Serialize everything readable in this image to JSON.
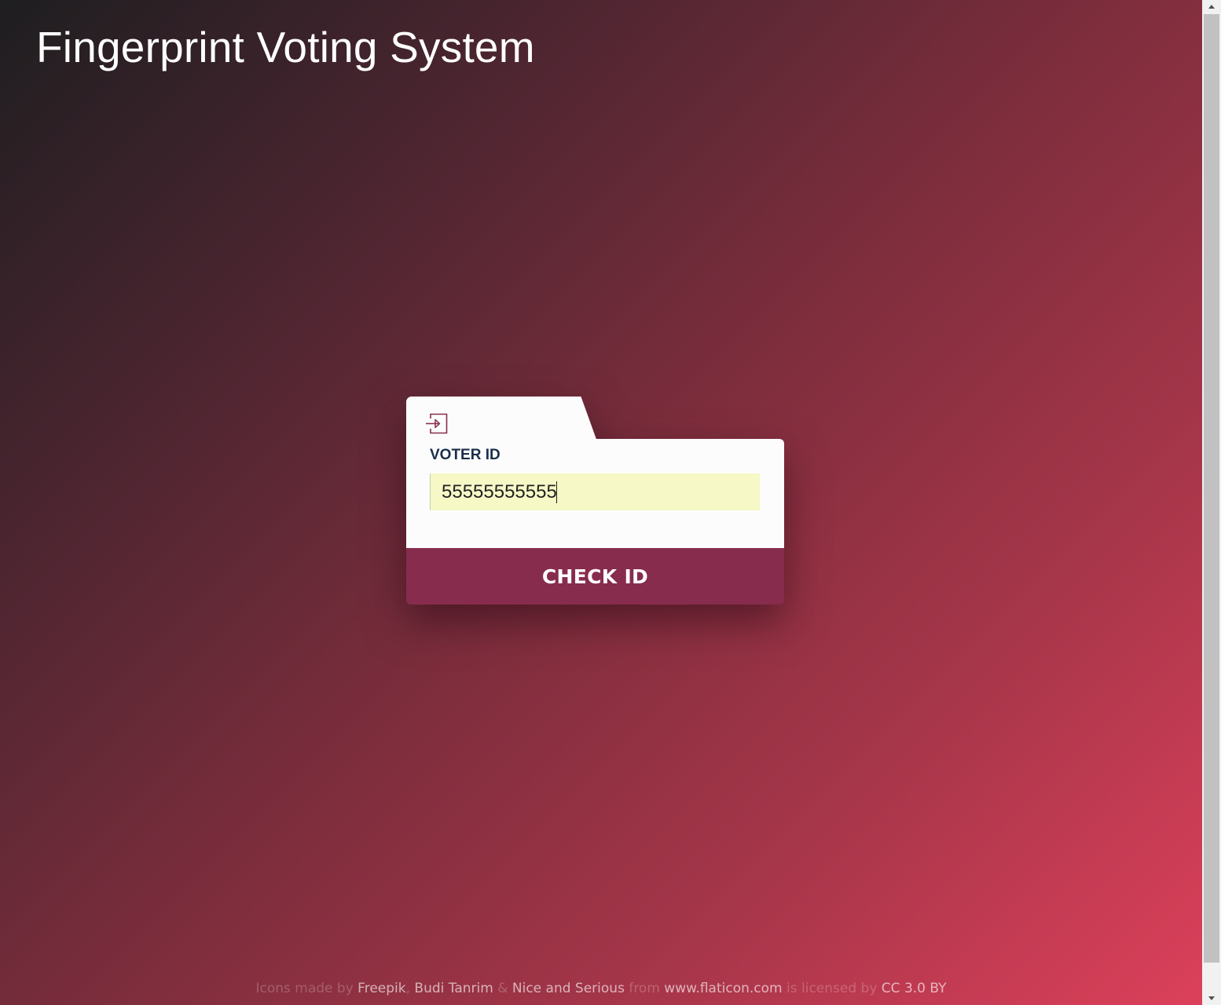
{
  "header": {
    "title": "Fingerprint Voting System"
  },
  "form": {
    "icon": "login-icon",
    "voter_id_label": "VOTER ID",
    "voter_id_value": "55555555555",
    "submit_label": "CHECK ID"
  },
  "footer": {
    "icons_made_by": "Icons made by",
    "author_1": "Freepik",
    "comma": ",",
    "author_2": "Budi Tanrim",
    "ampersand": "&",
    "author_3": "Nice and Serious",
    "from": "from",
    "site": "www.flaticon.com",
    "licensed_by": "is licensed by",
    "license": "CC 3.0 BY"
  },
  "colors": {
    "accent": "#872c4d",
    "input_background": "#f6f8c6",
    "label": "#1a2e4a"
  }
}
